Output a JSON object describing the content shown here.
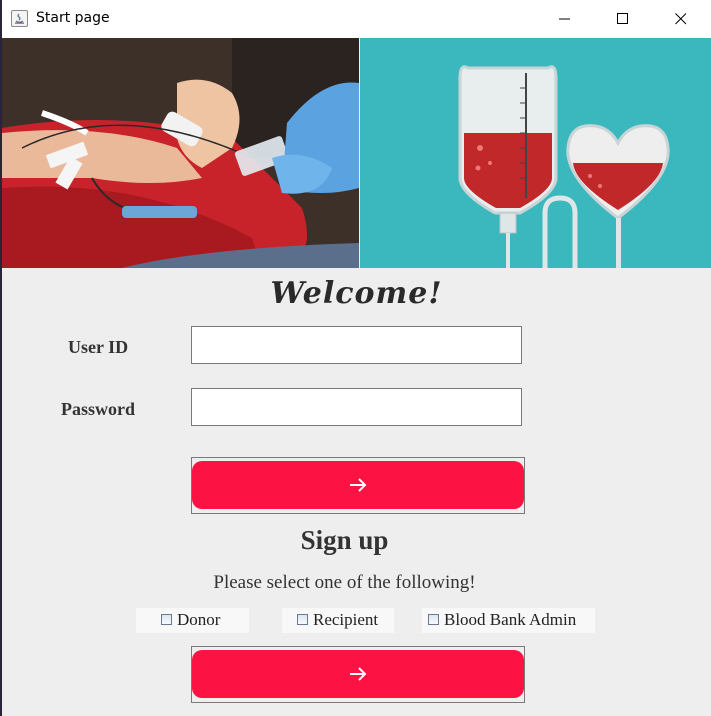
{
  "window": {
    "title": "Start page",
    "controls": [
      "minimize-icon",
      "maximize-icon",
      "close-icon"
    ]
  },
  "hero": {
    "left_image": "donor-arm-photo",
    "right_image": "blood-bag-heart-illustration"
  },
  "login": {
    "heading": "Welcome!",
    "user_id_label": "User ID",
    "user_id_value": "",
    "password_label": "Password",
    "password_value": "",
    "submit_icon": "arrow-right-icon"
  },
  "signup": {
    "heading": "Sign up",
    "instruction": "Please select one of the following!",
    "options": [
      {
        "label": "Donor",
        "checked": false
      },
      {
        "label": "Recipient",
        "checked": false
      },
      {
        "label": "Blood Bank Admin",
        "checked": false
      }
    ],
    "submit_icon": "arrow-right-icon"
  },
  "colors": {
    "accent_button": "#fd1343",
    "background": "#eeeeee",
    "hero_teal": "#3bb8bd"
  }
}
